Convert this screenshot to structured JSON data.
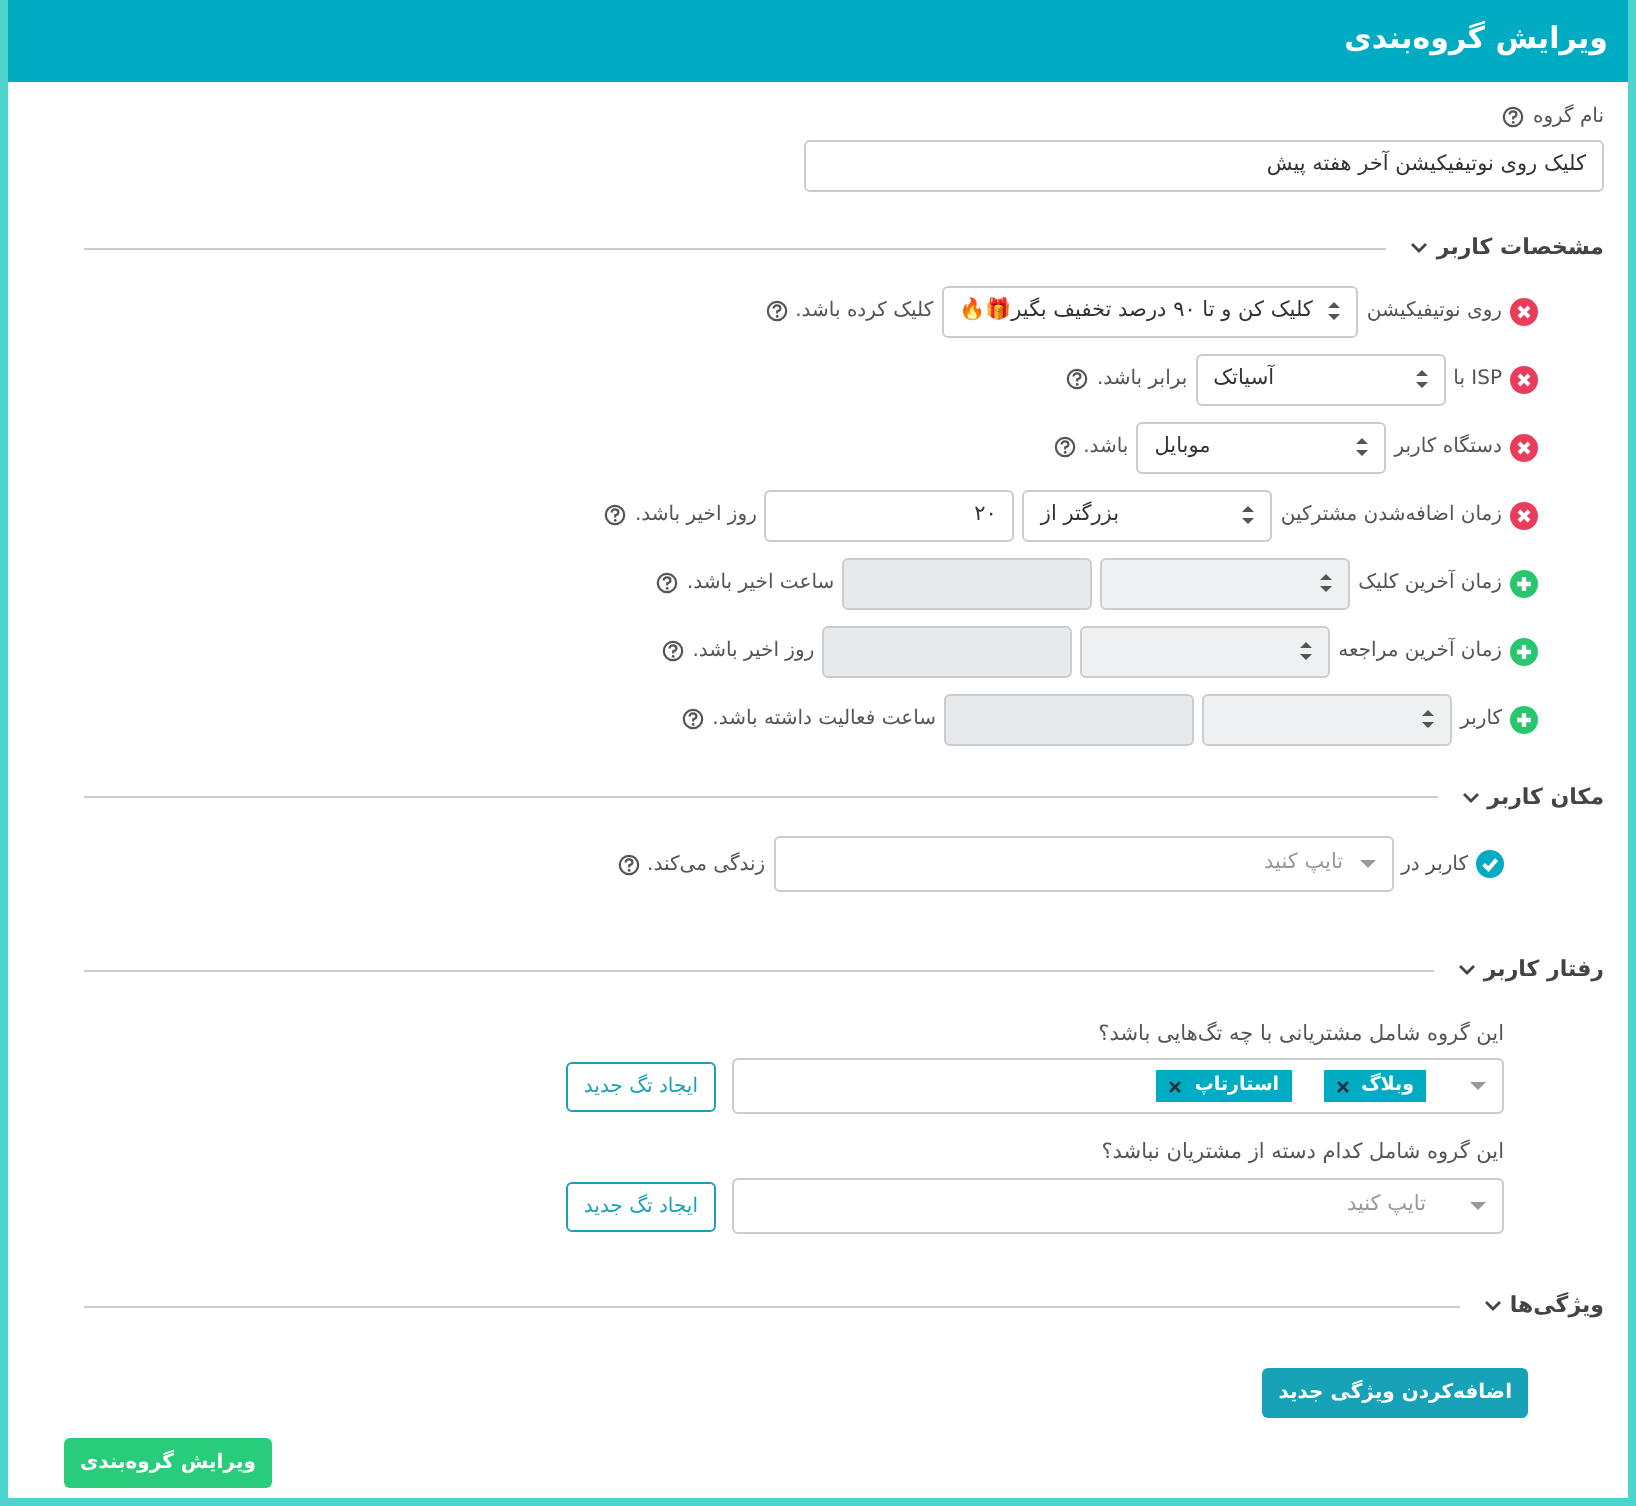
{
  "header": {
    "title": "ویرایش گروه‌بندی"
  },
  "group_name": {
    "label": "نام گروه",
    "value": "کلیک روی نوتیفیکیشن آخر هفته پیش"
  },
  "user_specs": {
    "title": "مشخصات کاربر",
    "expanded": true,
    "criteria": [
      {
        "removable": true,
        "kind": "select",
        "label": "روی نوتیفیکیشن",
        "select": "کلیک کن و تا ۹۰ درصد تخفیف بگیر🎁🔥",
        "suffix": "کلیک کرده باشد.",
        "enabled": true
      },
      {
        "removable": true,
        "kind": "select",
        "label": "ISP با",
        "select": "آسیاتک",
        "suffix": "برابر باشد.",
        "enabled": true
      },
      {
        "removable": true,
        "kind": "select",
        "label": "دستگاه کاربر",
        "select": "موبایل",
        "suffix": "باشد.",
        "enabled": true
      },
      {
        "removable": true,
        "kind": "select-input",
        "label": "زمان اضافه‌شدن مشترکین",
        "select": "بزرگتر از",
        "input": "۲۰",
        "suffix": "روز اخیر باشد.",
        "enabled": true
      },
      {
        "removable": false,
        "kind": "select-input",
        "label": "زمان آخرین کلیک",
        "suffix": "ساعت اخیر باشد.",
        "enabled": false
      },
      {
        "removable": false,
        "kind": "select-input",
        "label": "زمان آخرین مراجعه",
        "suffix": "روز اخیر باشد.",
        "enabled": false
      },
      {
        "removable": false,
        "kind": "select-input",
        "label": "کاربر",
        "suffix": "ساعت فعالیت داشته باشد.",
        "enabled": false
      }
    ]
  },
  "user_location": {
    "title": "مکان کاربر",
    "expanded": true,
    "label": "کاربر در",
    "placeholder": "تایپ کنید",
    "suffix": "زندگی می‌کند."
  },
  "user_behavior": {
    "title": "رفتار کاربر",
    "expanded": true,
    "questions": [
      {
        "label": "این گروه شامل مشتریانی با چه تگ‌هایی باشد؟",
        "tags": [
          "وبلاگ",
          "استارتاپ"
        ],
        "button": "ایجاد تگ جدید"
      },
      {
        "label": "این گروه شامل کدام دسته از مشتریان نباشد؟",
        "placeholder": "تایپ کنید",
        "button": "ایجاد تگ جدید"
      }
    ]
  },
  "features": {
    "title": "ویژگی‌ها",
    "expanded": true,
    "button": "اضافه‌کردن ویژگی جدید"
  },
  "submit_button": "ویرایش گروه‌بندی"
}
